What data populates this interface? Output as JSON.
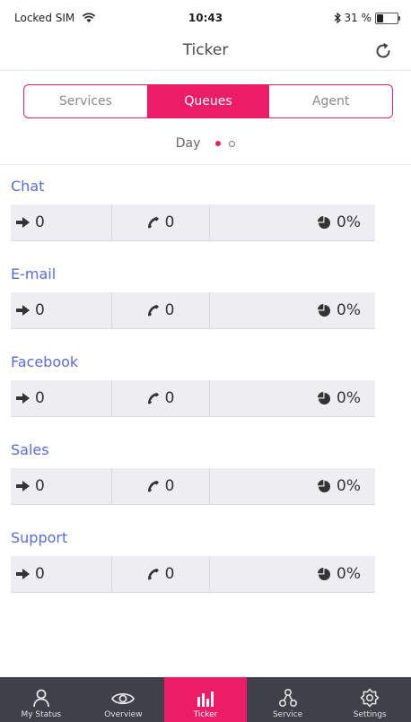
{
  "status_bar": {
    "carrier": "Locked SIM",
    "time": "10:43",
    "battery": "31 %",
    "battery_level": 0.31
  },
  "nav": {
    "title": "Ticker"
  },
  "segments": [
    {
      "label": "Services",
      "active": false
    },
    {
      "label": "Queues",
      "active": true
    },
    {
      "label": "Agent",
      "active": false
    }
  ],
  "pager": {
    "label": "Day",
    "pages": 2,
    "current": 1
  },
  "queues": [
    {
      "name": "Chat",
      "waiting": "0",
      "calls": "0",
      "percent": "0%"
    },
    {
      "name": "E-mail",
      "waiting": "0",
      "calls": "0",
      "percent": "0%"
    },
    {
      "name": "Facebook",
      "waiting": "0",
      "calls": "0",
      "percent": "0%"
    },
    {
      "name": "Sales",
      "waiting": "0",
      "calls": "0",
      "percent": "0%"
    },
    {
      "name": "Support",
      "waiting": "0",
      "calls": "0",
      "percent": "0%"
    }
  ],
  "tabbar": {
    "items": [
      {
        "label": "My Status",
        "icon": "person-icon"
      },
      {
        "label": "Overview",
        "icon": "eye-icon"
      },
      {
        "label": "Ticker",
        "icon": "bar-chart-icon",
        "active": true
      },
      {
        "label": "Service",
        "icon": "network-icon"
      },
      {
        "label": "Settings",
        "icon": "gear-icon"
      }
    ]
  },
  "colors": {
    "accent": "#ec1c66",
    "link": "#5b6bd6",
    "tabbar": "#3f4049",
    "row_bg": "#eeeef2"
  }
}
